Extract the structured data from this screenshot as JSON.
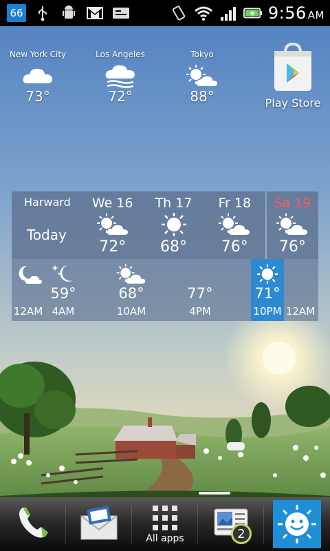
{
  "status_bar": {
    "notification_count": "66",
    "time": "9:56",
    "ampm": "AM",
    "icons": [
      "usb-icon",
      "android-debug-icon",
      "gmail-icon",
      "voicemail-icon",
      "vibrate-icon",
      "wifi-icon",
      "signal-icon",
      "battery-charging-icon"
    ]
  },
  "cities": [
    {
      "name": "New York City",
      "temp": "73°",
      "icon": "cloudy-icon"
    },
    {
      "name": "Los Angeles",
      "temp": "72°",
      "icon": "fog-icon"
    },
    {
      "name": "Tokyo",
      "temp": "88°",
      "icon": "partly-sunny-icon"
    }
  ],
  "play_store": {
    "label": "Play Store"
  },
  "forecast": {
    "location": "Harward",
    "today_label": "Today",
    "days": [
      {
        "name": "We 16",
        "temp": "72°",
        "icon": "partly-sunny-icon"
      },
      {
        "name": "Th 17",
        "temp": "68°",
        "icon": "sunny-icon"
      },
      {
        "name": "Fr 18",
        "temp": "76°",
        "icon": "partly-sunny-icon"
      },
      {
        "name": "Sa 19",
        "temp": "76°",
        "icon": "partly-sunny-icon"
      }
    ],
    "hourly": [
      {
        "time": "12AM",
        "temp": "",
        "icon": "moon-cloud-icon"
      },
      {
        "time": "4AM",
        "temp": "59°",
        "icon": "moon-stars-icon"
      },
      {
        "time": "10AM",
        "temp": "68°",
        "icon": "partly-sunny-icon"
      },
      {
        "time": "4PM",
        "temp": "77°",
        "icon": ""
      },
      {
        "time": "10PM",
        "temp": "71°",
        "icon": "sunny-icon"
      },
      {
        "time": "12AM",
        "temp": "",
        "icon": ""
      }
    ]
  },
  "dock": {
    "all_apps_label": "All apps",
    "gallery_badge": "2"
  },
  "colors": {
    "weekend": "#ff5a5a",
    "now_highlight": "#2e8ad0"
  }
}
